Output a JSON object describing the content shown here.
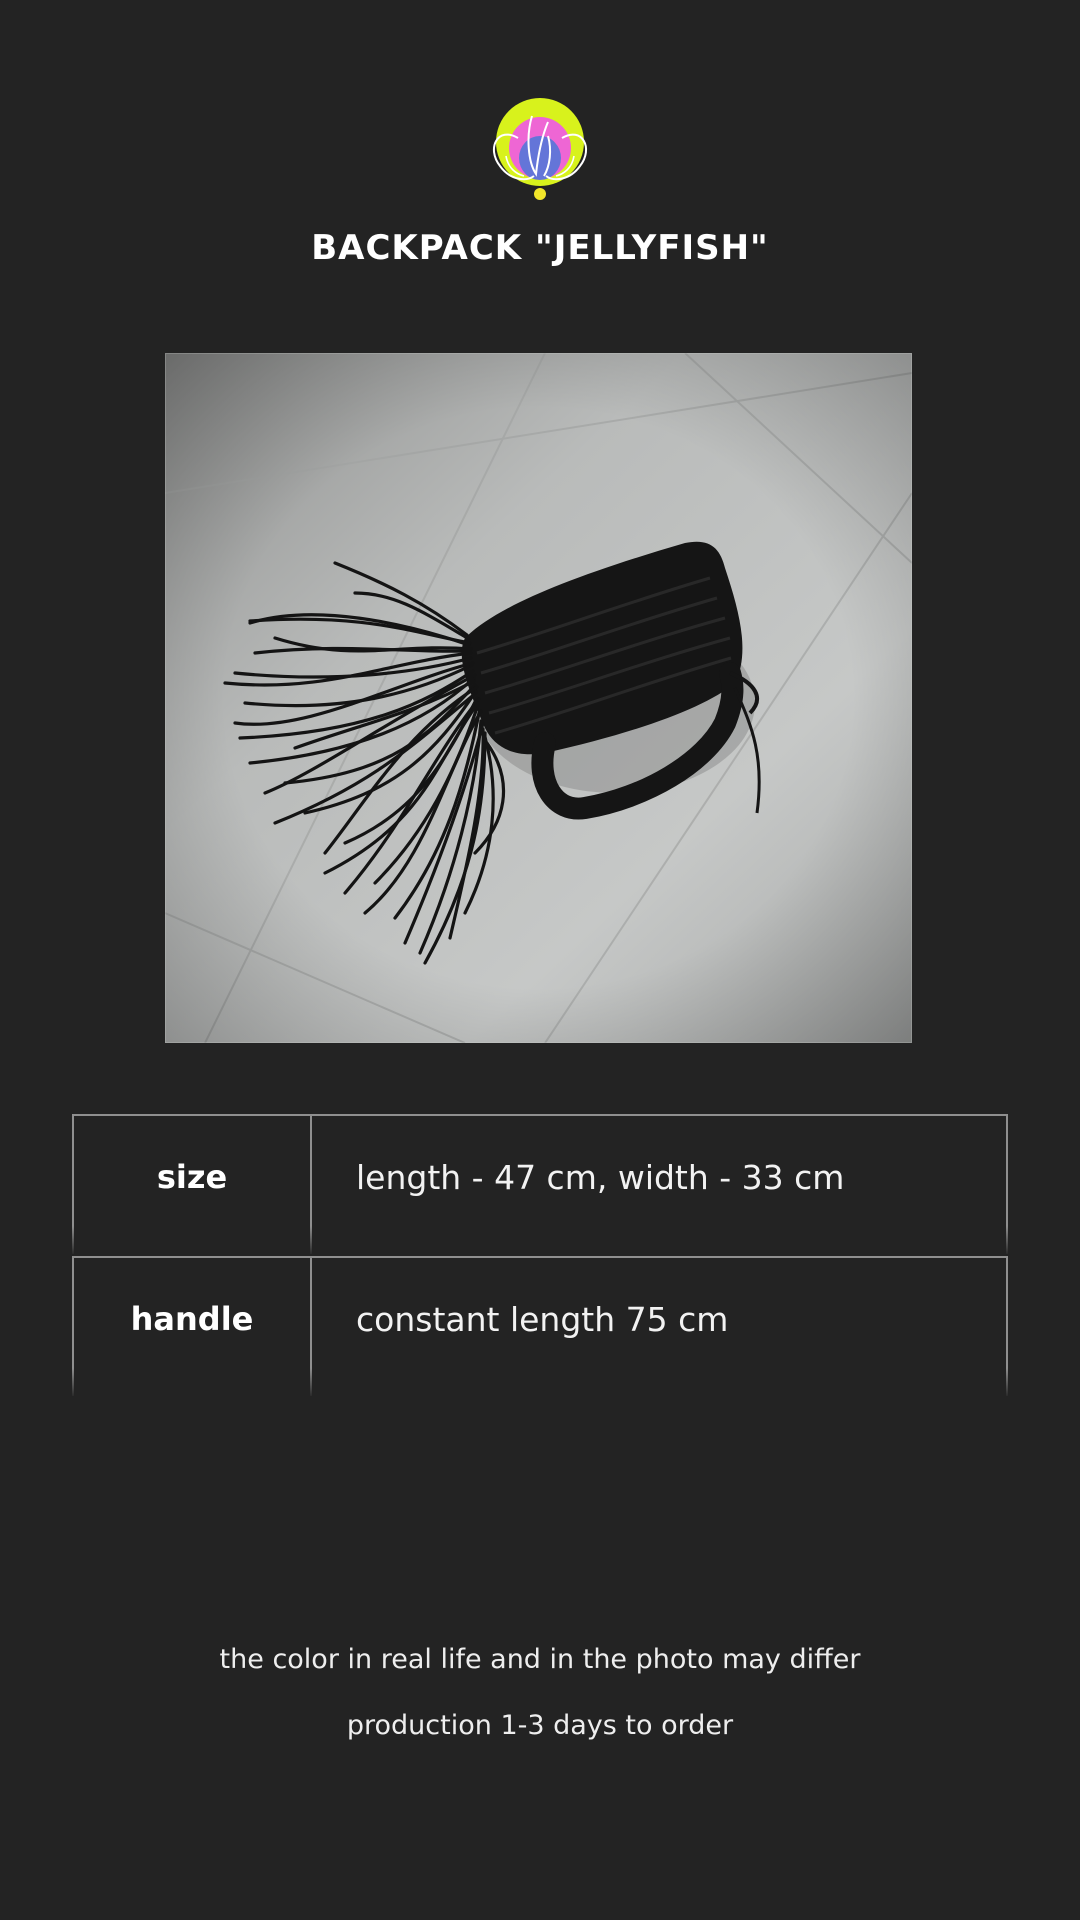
{
  "product": {
    "title": "BACKPACK \"JELLYFISH\"",
    "logo_icon": "jellyfish-logo-icon",
    "photo_icon": "crochet-fringe-backpack-photo"
  },
  "specs": [
    {
      "label": "size",
      "value": "length - 47 cm, width - 33 cm"
    },
    {
      "label": "handle",
      "value": "constant length 75 cm"
    }
  ],
  "notes": [
    "the color in real life and in the photo may differ",
    "production 1-3 days to order"
  ],
  "colors": {
    "background": "#232323",
    "logo_lime": "#d8f21c",
    "logo_pink": "#ee66d4",
    "logo_blue": "#6475d8",
    "logo_yellow": "#f2e62a",
    "table_border": "#8f8f8f"
  }
}
